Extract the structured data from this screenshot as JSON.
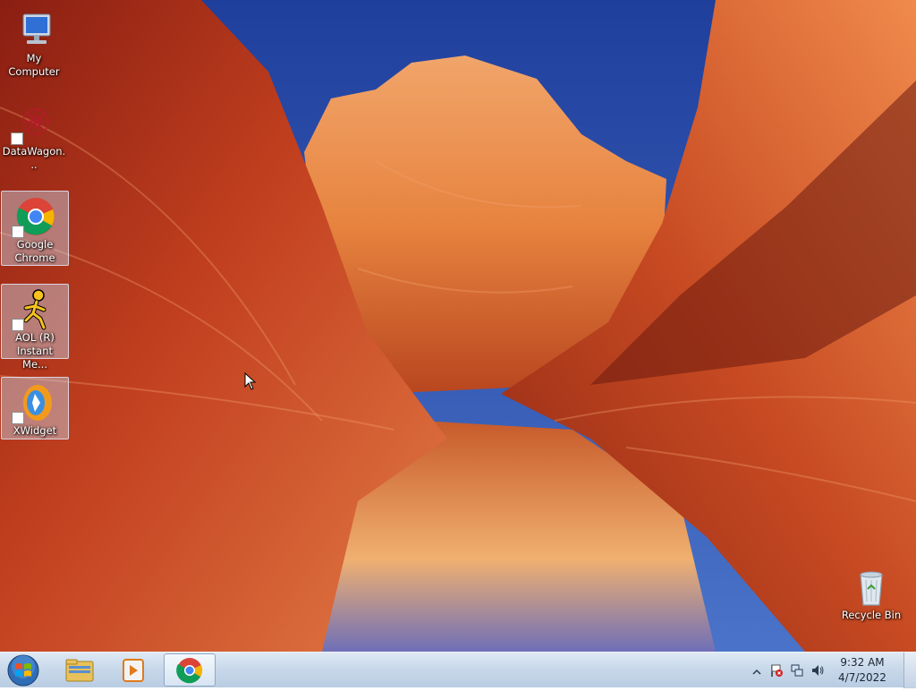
{
  "desktop": {
    "icons": [
      {
        "label": "My Computer"
      },
      {
        "label": "DataWagon..."
      },
      {
        "label": "Google Chrome"
      },
      {
        "label": "AOL (R) Instant Me..."
      },
      {
        "label": "XWidget"
      },
      {
        "label": "Recycle Bin"
      }
    ]
  },
  "taskbar": {
    "start_icon": "windows-start-orb-icon",
    "pinned": [
      {
        "icon": "file-explorer-icon"
      },
      {
        "icon": "media-player-icon"
      },
      {
        "icon": "chrome-icon",
        "active": true
      }
    ],
    "tray": {
      "icons": [
        "show-hidden-icons-chevron",
        "action-center-flag-icon",
        "network-icon",
        "volume-icon"
      ]
    },
    "clock": {
      "time": "9:32 AM",
      "date": "4/7/2022"
    }
  },
  "colors": {
    "sky": "#2a4fa8",
    "rock": "#d2552a",
    "taskbar": "#c9d9ea"
  }
}
